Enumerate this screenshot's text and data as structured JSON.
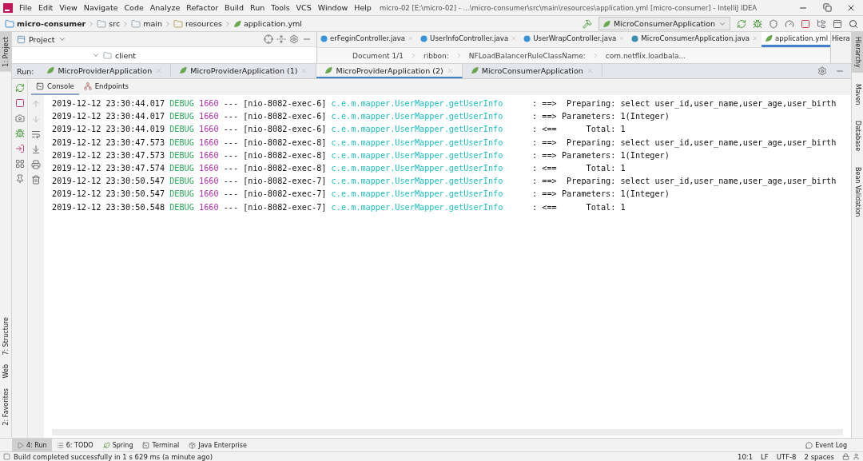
{
  "menu": [
    "File",
    "Edit",
    "View",
    "Navigate",
    "Code",
    "Analyze",
    "Refactor",
    "Build",
    "Run",
    "Tools",
    "VCS",
    "Window",
    "Help"
  ],
  "window": {
    "title": "micro-02 [E:\\micro-02] - ...\\micro-consumer\\src\\main\\resources\\application.yml [micro-consumer] - IntelliJ IDEA"
  },
  "navbar": {
    "crumbs": [
      {
        "label": "micro-consumer",
        "kind": "module"
      },
      {
        "label": "src",
        "kind": "folder"
      },
      {
        "label": "main",
        "kind": "folder"
      },
      {
        "label": "resources",
        "kind": "resources"
      },
      {
        "label": "application.yml",
        "kind": "yml"
      }
    ],
    "run_config": "MicroConsumerApplication"
  },
  "left_stripe": {
    "top": [
      {
        "label": "1: Project",
        "selected": true
      }
    ],
    "bottom": [
      {
        "label": "7: Structure",
        "selected": false
      },
      {
        "label": "Web",
        "selected": false
      },
      {
        "label": "2: Favorites",
        "selected": false
      }
    ]
  },
  "project_panel": {
    "title": "Project",
    "tree_item": "client"
  },
  "editor_tabs": [
    {
      "label": "erFeginController.java",
      "kind": "java",
      "selected": false
    },
    {
      "label": "UserInfoController.java",
      "kind": "java",
      "selected": false
    },
    {
      "label": "UserWrapController.java",
      "kind": "java",
      "selected": false
    },
    {
      "label": "MicroConsumerApplication.java",
      "kind": "spring",
      "selected": false
    },
    {
      "label": "application.yml",
      "kind": "yml",
      "selected": true
    }
  ],
  "hierarchy_header": "Hiera",
  "editor_breadcrumb": [
    "Document 1/1",
    "ribbon:",
    "NFLoadBalancerRuleClassName:",
    "com.netflix.loadbala..."
  ],
  "right_stripe": [
    {
      "label": "Hierarchy",
      "selected": true
    },
    {
      "label": "Maven",
      "selected": false
    },
    {
      "label": "Database",
      "selected": false
    },
    {
      "label": "Bean Validation",
      "selected": false
    }
  ],
  "run": {
    "label": "Run:",
    "tabs": [
      {
        "label": "MicroProviderApplication",
        "selected": false
      },
      {
        "label": "MicroProviderApplication (1)",
        "selected": false
      },
      {
        "label": "MicroProviderApplication (2)",
        "selected": true
      },
      {
        "label": "MicroConsumerApplication",
        "selected": false
      }
    ],
    "subtabs": [
      {
        "label": "Console",
        "selected": true
      },
      {
        "label": "Endpoints",
        "selected": false
      }
    ],
    "lines": [
      {
        "time": "2019-12-12 23:30:44.017",
        "level": "DEBUG",
        "pid": "1660",
        "sep": "---",
        "thread": "[nio-8082-exec-6]",
        "logger": "c.e.m.mapper.UserMapper.getUserInfo",
        "message": ": ==>  Preparing: select user_id,user_name,user_age,user_birth"
      },
      {
        "time": "2019-12-12 23:30:44.017",
        "level": "DEBUG",
        "pid": "1660",
        "sep": "---",
        "thread": "[nio-8082-exec-6]",
        "logger": "c.e.m.mapper.UserMapper.getUserInfo",
        "message": ": ==> Parameters: 1(Integer)"
      },
      {
        "time": "2019-12-12 23:30:44.019",
        "level": "DEBUG",
        "pid": "1660",
        "sep": "---",
        "thread": "[nio-8082-exec-6]",
        "logger": "c.e.m.mapper.UserMapper.getUserInfo",
        "message": ": <==      Total: 1"
      },
      {
        "time": "2019-12-12 23:30:47.573",
        "level": "DEBUG",
        "pid": "1660",
        "sep": "---",
        "thread": "[nio-8082-exec-8]",
        "logger": "c.e.m.mapper.UserMapper.getUserInfo",
        "message": ": ==>  Preparing: select user_id,user_name,user_age,user_birth"
      },
      {
        "time": "2019-12-12 23:30:47.573",
        "level": "DEBUG",
        "pid": "1660",
        "sep": "---",
        "thread": "[nio-8082-exec-8]",
        "logger": "c.e.m.mapper.UserMapper.getUserInfo",
        "message": ": ==> Parameters: 1(Integer)"
      },
      {
        "time": "2019-12-12 23:30:47.574",
        "level": "DEBUG",
        "pid": "1660",
        "sep": "---",
        "thread": "[nio-8082-exec-8]",
        "logger": "c.e.m.mapper.UserMapper.getUserInfo",
        "message": ": <==      Total: 1"
      },
      {
        "time": "2019-12-12 23:30:50.547",
        "level": "DEBUG",
        "pid": "1660",
        "sep": "---",
        "thread": "[nio-8082-exec-7]",
        "logger": "c.e.m.mapper.UserMapper.getUserInfo",
        "message": ": ==>  Preparing: select user_id,user_name,user_age,user_birth"
      },
      {
        "time": "2019-12-12 23:30:50.547",
        "level": "DEBUG",
        "pid": "1660",
        "sep": "---",
        "thread": "[nio-8082-exec-7]",
        "logger": "c.e.m.mapper.UserMapper.getUserInfo",
        "message": ": ==> Parameters: 1(Integer)"
      },
      {
        "time": "2019-12-12 23:30:50.548",
        "level": "DEBUG",
        "pid": "1660",
        "sep": "---",
        "thread": "[nio-8082-exec-7]",
        "logger": "c.e.m.mapper.UserMapper.getUserInfo",
        "message": ": <==      Total: 1"
      }
    ]
  },
  "bottom_tabs": [
    {
      "label": "4: Run",
      "kind": "run",
      "selected": true
    },
    {
      "label": "6: TODO",
      "kind": "todo",
      "selected": false
    },
    {
      "label": "Spring",
      "kind": "spring",
      "selected": false
    },
    {
      "label": "Terminal",
      "kind": "terminal",
      "selected": false
    },
    {
      "label": "Java Enterprise",
      "kind": "enterprise",
      "selected": false
    }
  ],
  "event_log": "Event Log",
  "status": {
    "message": "Build completed successfully in 1 s 629 ms (a minute ago)",
    "items": [
      "10:1",
      "LF",
      "UTF-8",
      "2 spaces"
    ]
  }
}
